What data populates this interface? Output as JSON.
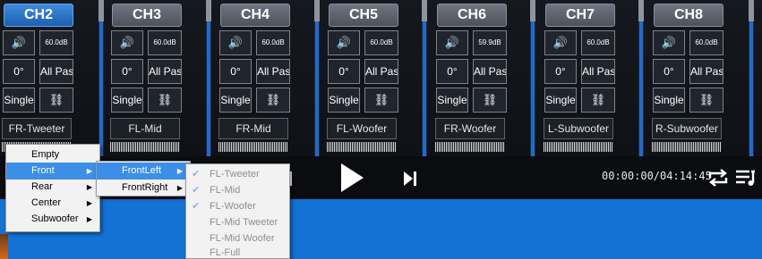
{
  "channels": [
    {
      "label": "CH2",
      "gain": "60.0dB",
      "phase": "0°",
      "filter": "All Pass",
      "mode": "Single",
      "speaker": "FR-Tweeter",
      "active": true
    },
    {
      "label": "CH3",
      "gain": "60.0dB",
      "phase": "0°",
      "filter": "All Pass",
      "mode": "Single",
      "speaker": "FL-Mid",
      "active": false
    },
    {
      "label": "CH4",
      "gain": "60.0dB",
      "phase": "0°",
      "filter": "All Pass",
      "mode": "Single",
      "speaker": "FR-Mid",
      "active": false
    },
    {
      "label": "CH5",
      "gain": "60.0dB",
      "phase": "0°",
      "filter": "All Pass",
      "mode": "Single",
      "speaker": "FL-Woofer",
      "active": false
    },
    {
      "label": "CH6",
      "gain": "59.9dB",
      "phase": "0°",
      "filter": "All Pass",
      "mode": "Single",
      "speaker": "FR-Woofer",
      "active": false
    },
    {
      "label": "CH7",
      "gain": "60.0dB",
      "phase": "0°",
      "filter": "All Pass",
      "mode": "Single",
      "speaker": "L-Subwoofer",
      "active": false
    },
    {
      "label": "CH8",
      "gain": "60.0dB",
      "phase": "0°",
      "filter": "All Pass",
      "mode": "Single",
      "speaker": "R-Subwoofer",
      "active": false
    }
  ],
  "icons": {
    "speaker": "speaker-volume-icon",
    "link": "link-icon",
    "prev": "skip-back-icon",
    "play": "play-icon",
    "next": "skip-next-icon",
    "repeat": "repeat-icon",
    "playlist": "playlist-icon"
  },
  "player": {
    "time": "00:00:00/04:14:45"
  },
  "menu1": {
    "items": [
      "Empty",
      "Front",
      "Rear",
      "Center",
      "Subwoofer"
    ],
    "selected": "Front"
  },
  "menu2": {
    "items": [
      "FrontLeft",
      "FrontRight"
    ],
    "selected": "FrontLeft"
  },
  "menu3": {
    "items": [
      "FL-Tweeter",
      "FL-Mid",
      "FL-Woofer",
      "FL-Mid Tweeter",
      "FL-Mid Woofer",
      "FL-Full"
    ],
    "checked": [
      "FL-Tweeter",
      "FL-Mid",
      "FL-Woofer"
    ]
  },
  "colors": {
    "active": "#2f7fd8",
    "menu_highlight": "#3d8ee6",
    "desktop": "#1372d4"
  }
}
